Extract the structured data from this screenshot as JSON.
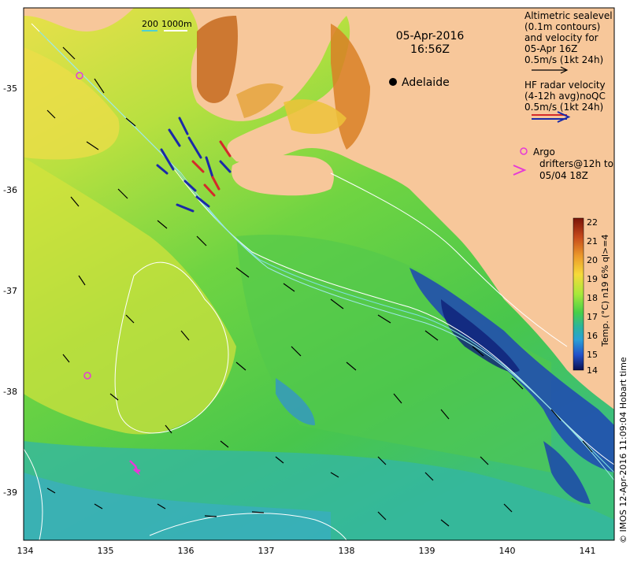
{
  "title": {
    "date": "05-Apr-2016",
    "time": "16:56Z"
  },
  "scale_bar": {
    "depth_a": "200",
    "depth_b": "1000m"
  },
  "city": {
    "name": "Adelaide"
  },
  "legend_altimetry": {
    "lines": [
      "Altimetric sealevel",
      "(0.1m contours)",
      "and velocity for",
      "05-Apr 16Z",
      "0.5m/s (1kt 24h)"
    ]
  },
  "legend_radar": {
    "lines": [
      "HF radar velocity",
      "(4-12h avg)noQC",
      "0.5m/s (1kt 24h)"
    ]
  },
  "legend_argo": {
    "lines": [
      "Argo",
      "drifters@12h to",
      "05/04 18Z"
    ]
  },
  "colorbar": {
    "label": "Temp. (°C) n19 6% ql>=4",
    "ticks": [
      "22",
      "21",
      "20",
      "19",
      "18",
      "17",
      "16",
      "15",
      "14"
    ],
    "colors": [
      "#8b1a0e",
      "#c8501a",
      "#e89a2c",
      "#f3d43a",
      "#d8ef3a",
      "#8ee23a",
      "#3fcf4a",
      "#20b07a",
      "#2aa6c8",
      "#2a66d6",
      "#1a2a9c",
      "#0a1450"
    ]
  },
  "axes": {
    "x_ticks": [
      "134",
      "135",
      "136",
      "137",
      "138",
      "139",
      "140",
      "141"
    ],
    "y_ticks": [
      "-35",
      "-36",
      "-37",
      "-38",
      "-39"
    ]
  },
  "credit": "© IMOS 12-Apr-2016 11:09:04 Hobart time",
  "colors": {
    "land": "#f7c79a",
    "sea_warm": "#e7e34a",
    "sea_mid": "#7fd53f",
    "sea_green": "#4cc84a",
    "sea_cool": "#2fb69a",
    "sea_cold": "#1a3fae",
    "argo": "#e63ad6",
    "radar_blue": "#1a2aa8",
    "radar_red": "#d42a2a"
  }
}
